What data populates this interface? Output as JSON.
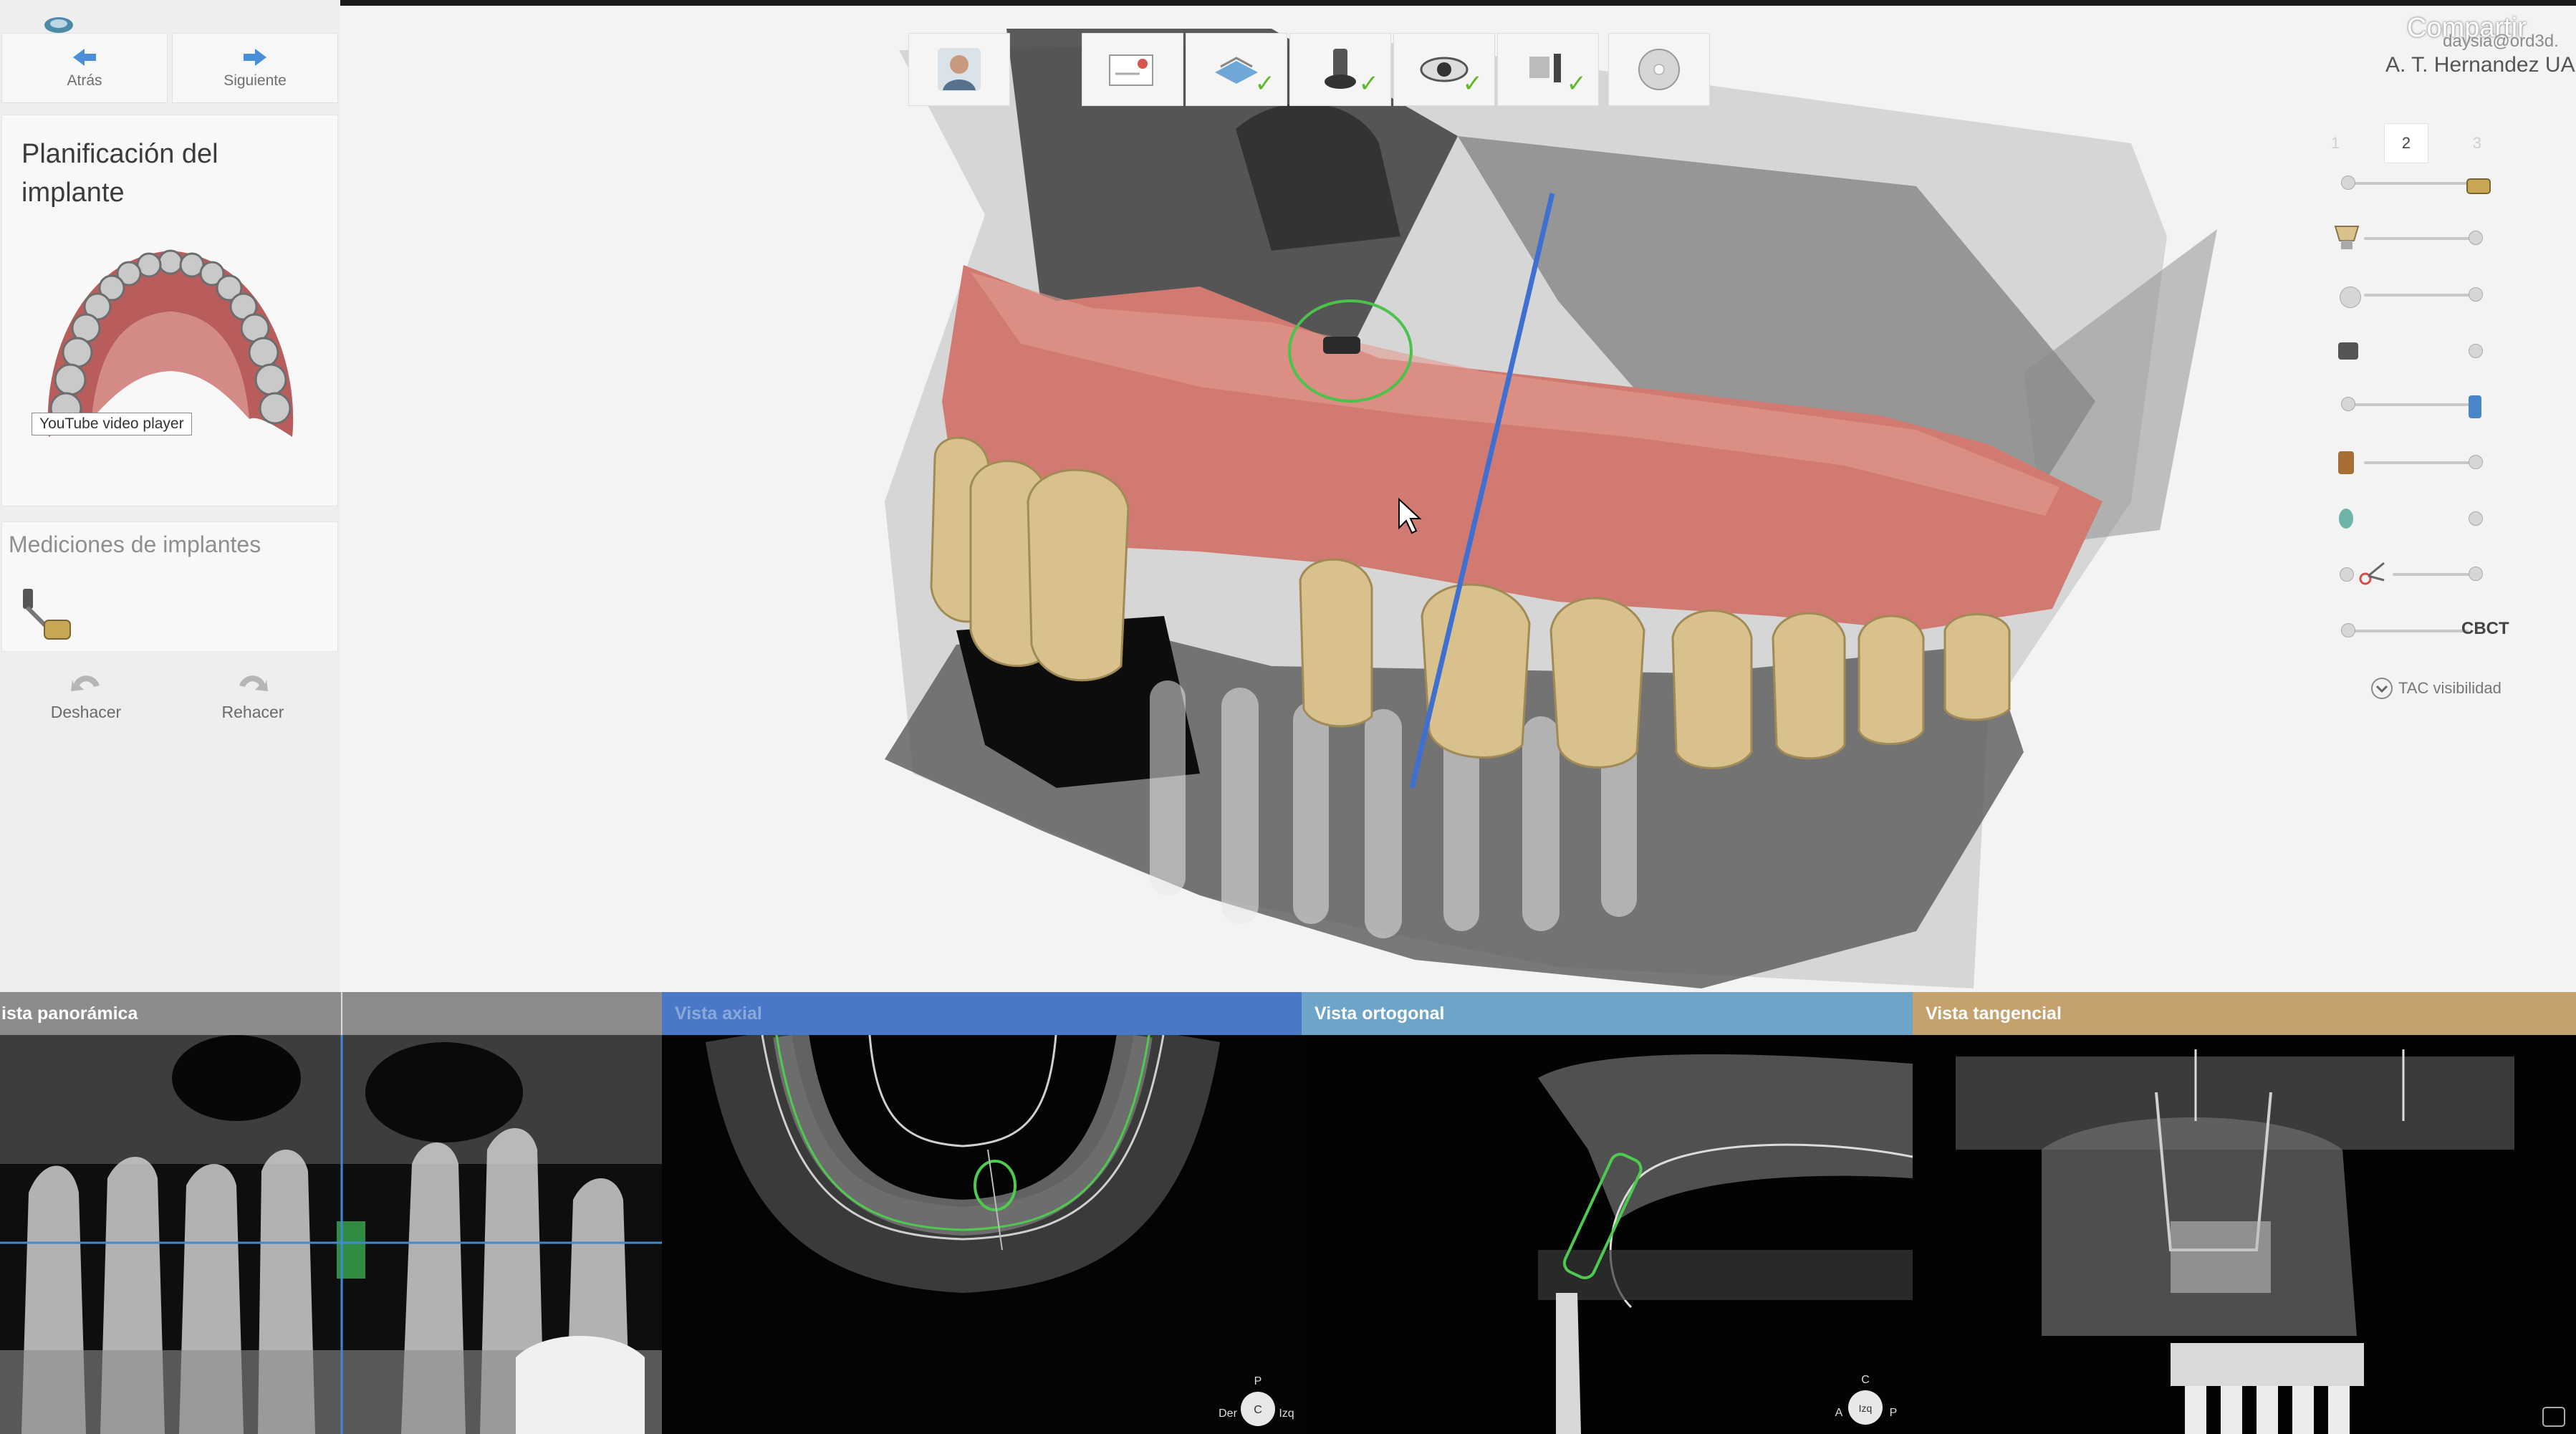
{
  "nav": {
    "back_label": "Atrás",
    "next_label": "Siguiente"
  },
  "left_panel": {
    "title": "Planificación del implante",
    "video_tooltip": "YouTube video player",
    "measurements_title": "Mediciones de implantes",
    "undo_label": "Deshacer",
    "redo_label": "Rehacer"
  },
  "header": {
    "share_label": "Compartir",
    "user_email": "daysia@ord3d.",
    "user_name": "A. T. Hernandez UA"
  },
  "steps": {
    "step1": "1",
    "step2": "2",
    "step3": "3"
  },
  "right_panel": {
    "cbct_label": "CBCT",
    "tac_visibility_label": "TAC visibilidad"
  },
  "views": {
    "panoramic": "ista panorámica",
    "axial": "Vista axial",
    "orthogonal": "Vista ortogonal",
    "tangential": "Vista tangencial"
  },
  "orientation": {
    "axial_top": "P",
    "axial_left": "Der",
    "axial_center": "C",
    "axial_right": "Izq",
    "ortho_top": "C",
    "ortho_left": "A",
    "ortho_center": "Izq",
    "ortho_right": "P"
  },
  "colors": {
    "accent_blue": "#3f6fd1",
    "check_green": "#5fb92c",
    "header_gray": "#8c8c8c",
    "header_blue": "#4a78c6",
    "header_light_blue": "#6ea4c7",
    "header_tan": "#c5a16d"
  },
  "icons": [
    "back-arrow-icon",
    "next-arrow-icon",
    "undo-icon",
    "redo-icon",
    "implant-icon",
    "patient-icon",
    "eye-icon",
    "disc-icon",
    "scissors-icon",
    "chevron-down-icon"
  ]
}
